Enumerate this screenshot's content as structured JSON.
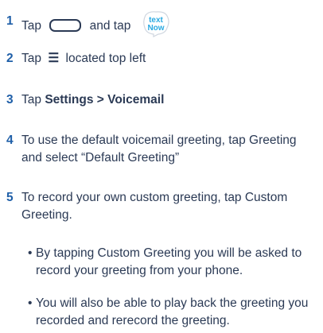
{
  "steps": [
    {
      "num": "1",
      "pre": "Tap",
      "mid": "and tap"
    },
    {
      "num": "2",
      "pre": "Tap",
      "menu_glyph": "☰",
      "post": "located top left"
    },
    {
      "num": "3",
      "pre": "Tap",
      "b1": "Settings",
      "sep": ">",
      "b2": "Voicemail"
    },
    {
      "num": "4",
      "text": "To use the default voicemail greeting, tap Greeting and select “Default Greeting”"
    },
    {
      "num": "5",
      "text": "To record your own custom greeting, tap Custom Greeting."
    }
  ],
  "bullets": [
    "By tapping Custom Greeting you will be asked to record your greeting from your phone.",
    "You will also be able to play back the greeting you recorded and rerecord the greeting."
  ],
  "icons": {
    "home_button": "home-button-icon",
    "logo": "textnow-logo-icon",
    "menu": "menu-icon"
  },
  "logo_text": {
    "line1": "text",
    "line2": "Now"
  },
  "colors": {
    "number": "#1f5fa8",
    "text": "#2b3a55",
    "logo_accent": "#29a9e1"
  }
}
